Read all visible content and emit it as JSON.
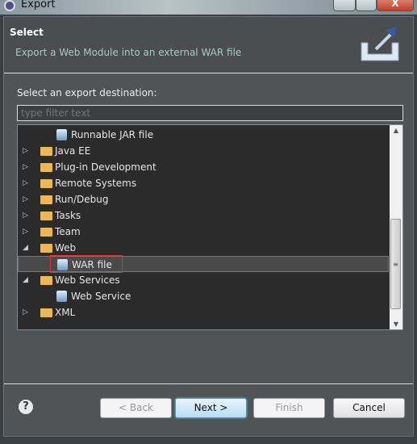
{
  "window": {
    "title": "Export",
    "minimize": "—",
    "maximize": "□",
    "close": "X"
  },
  "header": {
    "title": "Select",
    "description": "Export a Web Module into an external WAR file",
    "icon": "export-wizard-icon"
  },
  "label": "Select an export destination:",
  "filter": {
    "value": "",
    "placeholder": "type filter text"
  },
  "tree": [
    {
      "label": "Runnable JAR file",
      "level": 1,
      "type": "file"
    },
    {
      "label": "Java EE",
      "level": 0,
      "type": "folder",
      "expanded": false
    },
    {
      "label": "Plug-in Development",
      "level": 0,
      "type": "folder",
      "expanded": false
    },
    {
      "label": "Remote Systems",
      "level": 0,
      "type": "folder",
      "expanded": false
    },
    {
      "label": "Run/Debug",
      "level": 0,
      "type": "folder",
      "expanded": false
    },
    {
      "label": "Tasks",
      "level": 0,
      "type": "folder",
      "expanded": false
    },
    {
      "label": "Team",
      "level": 0,
      "type": "folder",
      "expanded": false
    },
    {
      "label": "Web",
      "level": 0,
      "type": "folder",
      "expanded": true
    },
    {
      "label": "WAR file",
      "level": 1,
      "type": "file",
      "selected": true
    },
    {
      "label": "Web Services",
      "level": 0,
      "type": "folder",
      "expanded": true
    },
    {
      "label": "Web Service",
      "level": 1,
      "type": "file"
    },
    {
      "label": "XML",
      "level": 0,
      "type": "folder",
      "expanded": false
    }
  ],
  "buttons": {
    "back": "< Back",
    "next": "Next >",
    "finish": "Finish",
    "cancel": "Cancel",
    "help": "?"
  }
}
